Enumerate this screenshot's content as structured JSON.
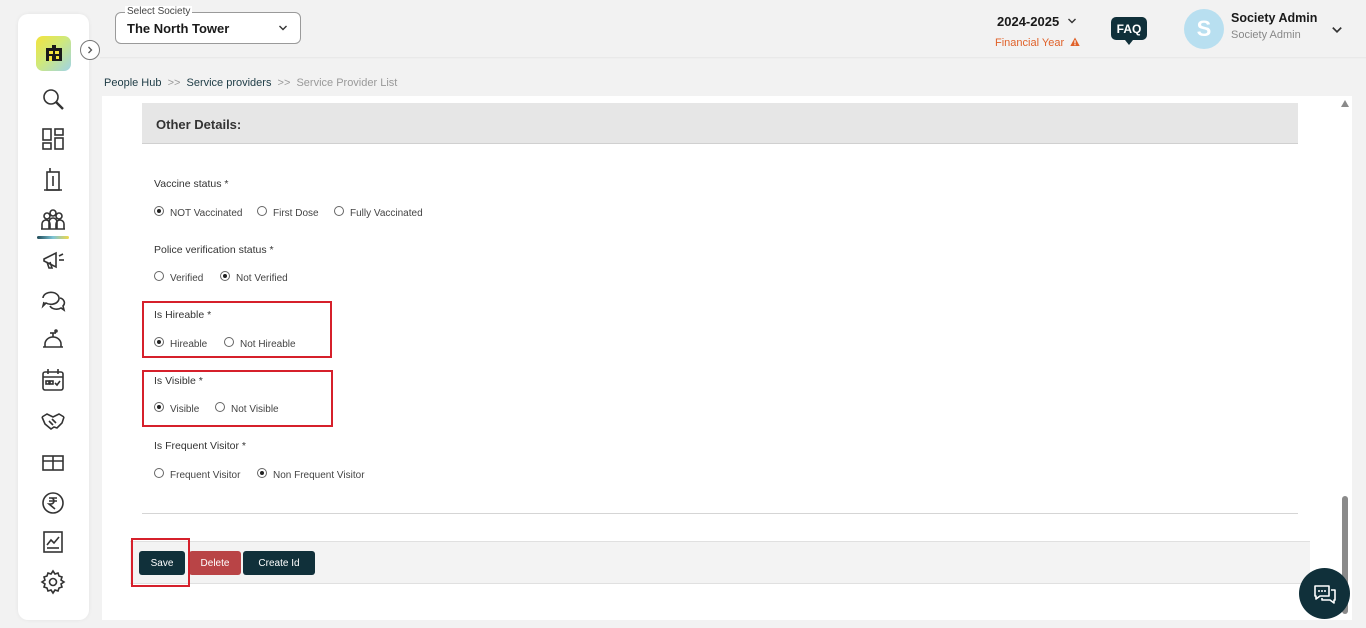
{
  "header": {
    "society_label": "Select Society",
    "society_value": "The North Tower",
    "financial_year": "2024-2025",
    "financial_year_label": "Financial Year",
    "faq_label": "FAQ",
    "avatar_letter": "S",
    "user_name": "Society Admin",
    "user_role": "Society Admin"
  },
  "breadcrumb": {
    "item1": "People Hub",
    "sep1": ">>",
    "item2": "Service providers",
    "sep2": ">>",
    "item3": "Service Provider List"
  },
  "section": {
    "title": "Other Details:"
  },
  "fields": {
    "vaccine": {
      "label": "Vaccine status *",
      "options": [
        "NOT Vaccinated",
        "First Dose",
        "Fully Vaccinated"
      ],
      "selected": "NOT Vaccinated"
    },
    "police": {
      "label": "Police verification status *",
      "options": [
        "Verified",
        "Not Verified"
      ],
      "selected": "Not Verified"
    },
    "hireable": {
      "label": "Is Hireable *",
      "options": [
        "Hireable",
        "Not Hireable"
      ],
      "selected": "Hireable"
    },
    "visible": {
      "label": "Is Visible *",
      "options": [
        "Visible",
        "Not Visible"
      ],
      "selected": "Visible"
    },
    "frequent": {
      "label": "Is Frequent Visitor *",
      "options": [
        "Frequent Visitor",
        "Non Frequent Visitor"
      ],
      "selected": "Non Frequent Visitor"
    }
  },
  "actions": {
    "save": "Save",
    "delete": "Delete",
    "create_id": "Create Id"
  },
  "colors": {
    "primary": "#10303a",
    "danger": "#b94446",
    "highlight": "#d6202b",
    "warning": "#e0622a"
  },
  "icons": {
    "sidebar": [
      "search-icon",
      "dashboard-icon",
      "building-icon",
      "people-icon",
      "megaphone-icon",
      "chat-icon",
      "service-bell-icon",
      "calendar-icon",
      "handshake-icon",
      "gift-icon",
      "rupee-icon",
      "report-icon",
      "settings-icon"
    ]
  }
}
